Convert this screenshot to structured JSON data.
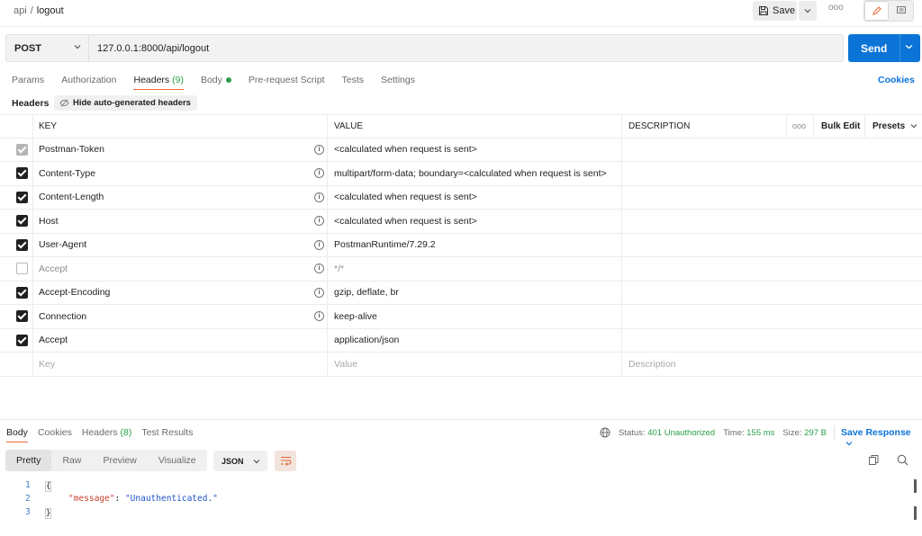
{
  "breadcrumb": {
    "parent": "api",
    "separator": "/",
    "current": "logout"
  },
  "toolbar": {
    "save_label": "Save",
    "more_label": "ooo"
  },
  "request": {
    "method": "POST",
    "url": "127.0.0.1:8000/api/logout",
    "send_label": "Send"
  },
  "request_tabs": [
    {
      "label": "Params",
      "count": ""
    },
    {
      "label": "Authorization",
      "count": ""
    },
    {
      "label": "Headers",
      "count": "(9)",
      "active": true
    },
    {
      "label": "Body",
      "count": "",
      "dot": true
    },
    {
      "label": "Pre-request Script",
      "count": ""
    },
    {
      "label": "Tests",
      "count": ""
    },
    {
      "label": "Settings",
      "count": ""
    }
  ],
  "cookies_label": "Cookies",
  "headers_section": {
    "title": "Headers",
    "hide_auto_label": "Hide auto-generated headers"
  },
  "table": {
    "columns": {
      "key": "KEY",
      "value": "VALUE",
      "description": "DESCRIPTION",
      "more": "ooo",
      "bulk_edit": "Bulk Edit",
      "presets": "Presets"
    },
    "rows": [
      {
        "key": "Postman-Token",
        "value": "<calculated when request is sent>",
        "check": "disabled",
        "info": true
      },
      {
        "key": "Content-Type",
        "value": "multipart/form-data; boundary=<calculated when request is sent>",
        "check": "on",
        "info": true
      },
      {
        "key": "Content-Length",
        "value": "<calculated when request is sent>",
        "check": "on",
        "info": true
      },
      {
        "key": "Host",
        "value": "<calculated when request is sent>",
        "check": "on",
        "info": true
      },
      {
        "key": "User-Agent",
        "value": "PostmanRuntime/7.29.2",
        "check": "on",
        "info": true
      },
      {
        "key": "Accept",
        "value": "*/*",
        "check": "off",
        "info": true
      },
      {
        "key": "Accept-Encoding",
        "value": "gzip, deflate, br",
        "check": "on",
        "info": true
      },
      {
        "key": "Connection",
        "value": "keep-alive",
        "check": "on",
        "info": true
      },
      {
        "key": "Accept",
        "value": "application/json",
        "check": "on",
        "info": false
      }
    ],
    "placeholder": {
      "key": "Key",
      "value": "Value",
      "description": "Description"
    }
  },
  "response_tabs": [
    {
      "label": "Body",
      "count": "",
      "active": true
    },
    {
      "label": "Cookies",
      "count": ""
    },
    {
      "label": "Headers",
      "count": "(8)"
    },
    {
      "label": "Test Results",
      "count": ""
    }
  ],
  "response_status": {
    "status_label": "Status:",
    "status_value": "401 Unauthorized",
    "time_label": "Time:",
    "time_value": "155 ms",
    "size_label": "Size:",
    "size_value": "297 B",
    "save_response": "Save Response"
  },
  "format_tabs": [
    "Pretty",
    "Raw",
    "Preview",
    "Visualize"
  ],
  "format_selected": "JSON",
  "code": {
    "line_numbers": [
      "1",
      "2",
      "3"
    ],
    "open_brace": "{",
    "close_brace": "}",
    "key": "\"message\"",
    "colon": ": ",
    "value": "\"Unauthenticated.\""
  },
  "colors": {
    "accent": "#0b74d6",
    "tab_underline": "#f26b3a",
    "status_green": "#2a9d4b"
  }
}
